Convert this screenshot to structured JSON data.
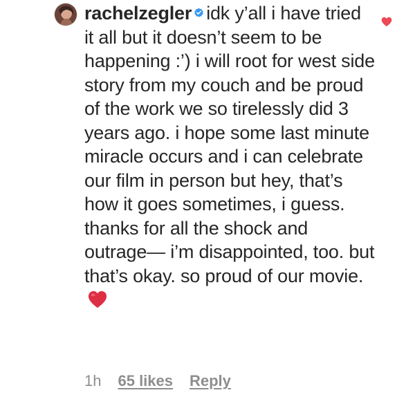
{
  "comment": {
    "username": "rachelzegler",
    "verified": true,
    "text": "idk y’all i have tried it all but it doesn’t seem to be happening :’) i will root for west side story from my couch and be proud of the work we so tirelessly did 3 years ago. i hope some last minute miracle occurs and i can celebrate our film in person but hey, that’s how it goes sometimes, i guess. thanks for all the shock and outrage— i’m disappointed, too. but that’s okay. so proud of our movie.",
    "emoji": "red-heart",
    "liked": true,
    "time": "1h",
    "likes_label": "65 likes",
    "reply_label": "Reply"
  },
  "colors": {
    "text": "#262626",
    "meta": "#8e8e8e",
    "verified_blue": "#3897f0",
    "like_red": "#ed4956",
    "emoji_red": "#dd2e44"
  },
  "icons": {
    "verified": "verified-badge-icon",
    "like": "heart-icon",
    "emoji": "red-heart-emoji-icon"
  }
}
